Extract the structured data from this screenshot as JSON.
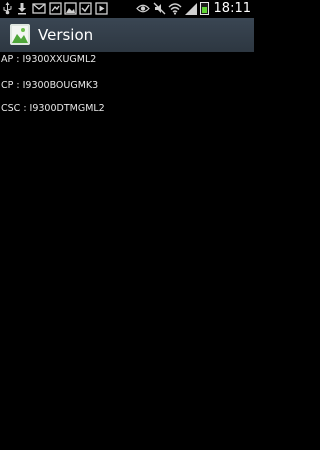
{
  "status_bar": {
    "time": "18:11",
    "icons": [
      "usb-icon",
      "download-icon",
      "mail-icon",
      "signal-booster-icon",
      "gallery-icon",
      "task-check-icon",
      "play-icon",
      "eye-icon",
      "mute-icon",
      "wifi-icon",
      "mobile-signal-icon",
      "battery-icon"
    ],
    "battery_level": 0.55
  },
  "action_bar": {
    "title": "Version",
    "icon": "app-icon"
  },
  "info": {
    "ap": "AP : I9300XXUGML2",
    "cp": "CP : I9300BOUGMK3",
    "csc": "CSC : I9300DTMGML2"
  },
  "colors": {
    "action_bar": "#313c48",
    "background": "#000000",
    "battery": "#5ed233"
  }
}
